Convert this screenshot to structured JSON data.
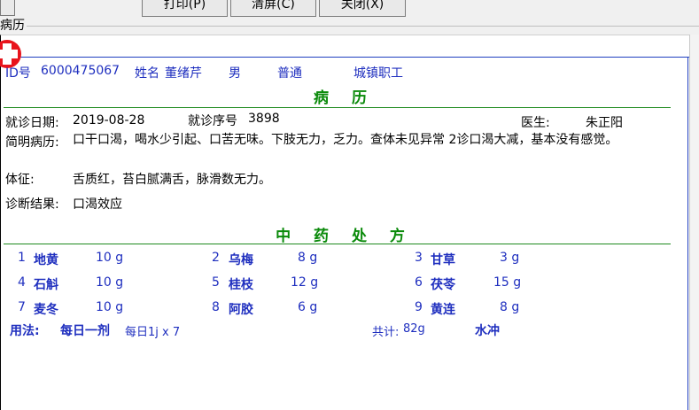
{
  "toolbar": {
    "print_label": "打印(P)",
    "clear_label": "清屏(C)",
    "close_label": "关闭(X)"
  },
  "group_label": "病历",
  "patient": {
    "id_label": "ID号",
    "id_value": "6000475067",
    "name_label": "姓名",
    "name_value": "董绪芹",
    "gender": "男",
    "visit_type": "普通",
    "insurance": "城镇职工"
  },
  "record": {
    "title": "病 历",
    "visit_date_label": "就诊日期:",
    "visit_date": "2019-08-28",
    "visit_no_label": "就诊序号",
    "visit_no": "3898",
    "doctor_label": "医生:",
    "doctor": "朱正阳",
    "history_label": "简明病历:",
    "history": "口干口渴，喝水少引起、口苦无味。下肢无力，乏力。查体未见异常 2诊口渴大减，基本没有感觉。",
    "signs_label": "体征:",
    "signs": "舌质红，苔白腻满舌，脉滑数无力。",
    "diagnosis_label": "诊断结果:",
    "diagnosis": "口渴效应"
  },
  "prescription": {
    "title": "中 药 处 方",
    "items": [
      {
        "no": "1",
        "name": "地黄",
        "dose": "10 g"
      },
      {
        "no": "2",
        "name": "乌梅",
        "dose": "8 g"
      },
      {
        "no": "3",
        "name": "甘草",
        "dose": "3 g"
      },
      {
        "no": "4",
        "name": "石斛",
        "dose": "10 g"
      },
      {
        "no": "5",
        "name": "桂枝",
        "dose": "12 g"
      },
      {
        "no": "6",
        "name": "茯苓",
        "dose": "15 g"
      },
      {
        "no": "7",
        "name": "麦冬",
        "dose": "10 g"
      },
      {
        "no": "8",
        "name": "阿胶",
        "dose": "6 g"
      },
      {
        "no": "9",
        "name": "黄连",
        "dose": "8 g"
      }
    ],
    "usage_label": "用法:",
    "usage_value": "每日一剂",
    "usage_detail": "每日1j x 7",
    "total_label": "共计:",
    "total_value": "82g",
    "method": "水冲"
  },
  "colors": {
    "accent_blue": "#1f2fbf",
    "title_green": "#0a8a0a",
    "cross_red": "#e8141c"
  }
}
